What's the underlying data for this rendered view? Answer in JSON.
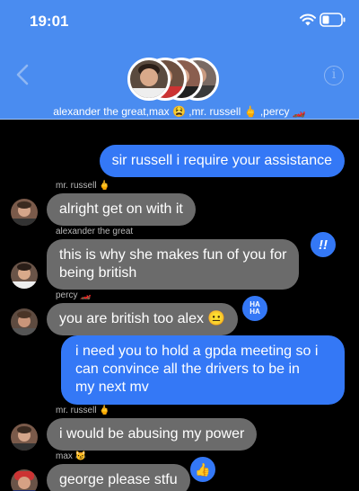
{
  "status_bar": {
    "time": "19:01"
  },
  "conversation": {
    "title": "alexander the great,max 😫 ,mr. russell 🖕 ,percy 🏎️"
  },
  "colors": {
    "header": "#4a8cf0",
    "outgoing_bubble": "#3478f6",
    "incoming_bubble": "#6b6b6b",
    "sender_label": "#b8b8b8"
  },
  "icons": {
    "back": "chevron-left-icon",
    "info": "info-icon",
    "wifi": "wifi-icon",
    "battery": "battery-icon"
  },
  "messages": [
    {
      "direction": "out",
      "text": "sir russell i require your assistance"
    },
    {
      "direction": "in",
      "sender": "mr. russell 🖕",
      "text": "alright get on with it"
    },
    {
      "direction": "in",
      "sender": "alexander the great",
      "text": "this is why she makes fun of you for\nbeing british",
      "tapback": "!!"
    },
    {
      "direction": "in",
      "sender": "percy 🏎️",
      "text": "you are british too alex 😐",
      "tapback": "HA HA"
    },
    {
      "direction": "out",
      "text": "i need you to hold a gpda meeting so i\ncan convince all the drivers to be in\nmy next mv"
    },
    {
      "direction": "in",
      "sender": "mr. russell 🖕",
      "text": "i would be abusing my power"
    },
    {
      "direction": "in",
      "sender": "max 😼",
      "text": "george please stfu",
      "tapback": "👍"
    }
  ]
}
